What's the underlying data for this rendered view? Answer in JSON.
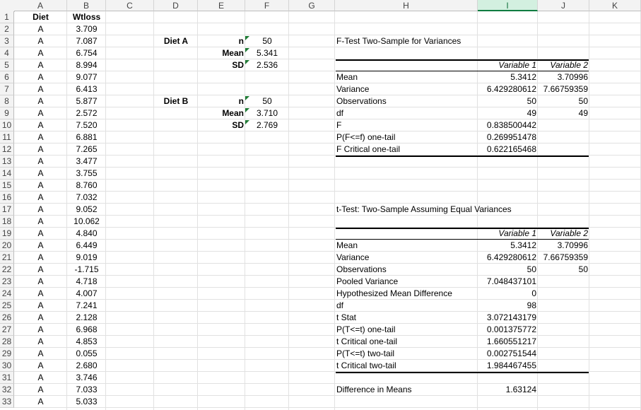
{
  "columns": [
    "A",
    "B",
    "C",
    "D",
    "E",
    "F",
    "G",
    "H",
    "I",
    "J",
    "K"
  ],
  "selected_column": "I",
  "rows": [
    "1",
    "2",
    "3",
    "4",
    "5",
    "6",
    "7",
    "8",
    "9",
    "10",
    "11",
    "12",
    "13",
    "14",
    "15",
    "16",
    "17",
    "18",
    "19",
    "20",
    "21",
    "22",
    "23",
    "24",
    "25",
    "26",
    "27",
    "28",
    "29",
    "30",
    "31",
    "32",
    "33"
  ],
  "data_table": {
    "headers": [
      "Diet",
      "Wtloss"
    ],
    "diet": [
      "A",
      "A",
      "A",
      "A",
      "A",
      "A",
      "A",
      "A",
      "A",
      "A",
      "A",
      "A",
      "A",
      "A",
      "A",
      "A",
      "A",
      "A",
      "A",
      "A",
      "A",
      "A",
      "A",
      "A",
      "A",
      "A",
      "A",
      "A",
      "A",
      "A",
      "A",
      "A"
    ],
    "wtloss": [
      "3.709",
      "7.087",
      "6.754",
      "8.994",
      "9.077",
      "6.413",
      "5.877",
      "2.572",
      "7.520",
      "6.881",
      "7.265",
      "3.477",
      "3.755",
      "8.760",
      "7.032",
      "9.052",
      "10.062",
      "4.840",
      "6.449",
      "9.019",
      "-1.715",
      "4.718",
      "4.007",
      "7.241",
      "2.128",
      "6.968",
      "4.853",
      "0.055",
      "2.680",
      "3.746",
      "7.033",
      "5.033"
    ]
  },
  "summary": {
    "diet_a": {
      "label": "Diet A",
      "n_label": "n",
      "mean_label": "Mean",
      "sd_label": "SD",
      "n": "50",
      "mean": "5.341",
      "sd": "2.536"
    },
    "diet_b": {
      "label": "Diet B",
      "n_label": "n",
      "mean_label": "Mean",
      "sd_label": "SD",
      "n": "50",
      "mean": "3.710",
      "sd": "2.769"
    }
  },
  "ftest": {
    "title": "F-Test Two-Sample for Variances",
    "var1": "Variable 1",
    "var2": "Variable 2",
    "rows": [
      {
        "label": "Mean",
        "v1": "5.3412",
        "v2": "3.70996"
      },
      {
        "label": "Variance",
        "v1": "6.429280612",
        "v2": "7.66759359"
      },
      {
        "label": "Observations",
        "v1": "50",
        "v2": "50"
      },
      {
        "label": "df",
        "v1": "49",
        "v2": "49"
      },
      {
        "label": "F",
        "v1": "0.838500442",
        "v2": ""
      },
      {
        "label": "P(F<=f) one-tail",
        "v1": "0.269951478",
        "v2": ""
      },
      {
        "label": "F Critical one-tail",
        "v1": "0.622165468",
        "v2": ""
      }
    ]
  },
  "ttest": {
    "title": "t-Test: Two-Sample Assuming Equal Variances",
    "var1": "Variable 1",
    "var2": "Variable 2",
    "rows": [
      {
        "label": "Mean",
        "v1": "5.3412",
        "v2": "3.70996"
      },
      {
        "label": "Variance",
        "v1": "6.429280612",
        "v2": "7.66759359"
      },
      {
        "label": "Observations",
        "v1": "50",
        "v2": "50"
      },
      {
        "label": "Pooled Variance",
        "v1": "7.048437101",
        "v2": ""
      },
      {
        "label": "Hypothesized Mean Difference",
        "v1": "0",
        "v2": ""
      },
      {
        "label": "df",
        "v1": "98",
        "v2": ""
      },
      {
        "label": "t Stat",
        "v1": "3.072143179",
        "v2": ""
      },
      {
        "label": "P(T<=t) one-tail",
        "v1": "0.001375772",
        "v2": ""
      },
      {
        "label": "t Critical one-tail",
        "v1": "1.660551217",
        "v2": ""
      },
      {
        "label": "P(T<=t) two-tail",
        "v1": "0.002751544",
        "v2": ""
      },
      {
        "label": "t Critical two-tail",
        "v1": "1.984467455",
        "v2": ""
      }
    ]
  },
  "difference": {
    "label": "Difference in Means",
    "value": "1.63124"
  },
  "colors": {
    "header_bg": "#f3f3f3",
    "selected_header_bg": "#d3f0e0",
    "selected_header_text": "#0f6e3a",
    "gridline": "#e1e1e1",
    "error_indicator": "#1e7b34"
  }
}
